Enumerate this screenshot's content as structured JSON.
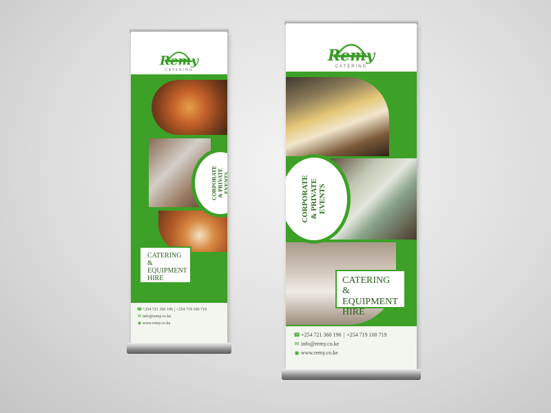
{
  "brand": {
    "name": "Remy",
    "tagline": "CATERING"
  },
  "banner": {
    "badge_line1": "CORPORATE",
    "badge_line2": "& PRIVATE",
    "badge_line3": "EVENTS",
    "cta_line1": "CATERING &",
    "cta_line2": "EQUIPMENT",
    "cta_line3": "HIRE"
  },
  "contact": {
    "phone_icon": "phone-icon",
    "phone1": "+254 721 360 196",
    "phone2": "+254 719 100 719",
    "email": "info@remy.co.ke",
    "website": "www.remy.co.ke"
  },
  "colors": {
    "brand_green": "#3ca126",
    "background": "#dcdcdc"
  }
}
